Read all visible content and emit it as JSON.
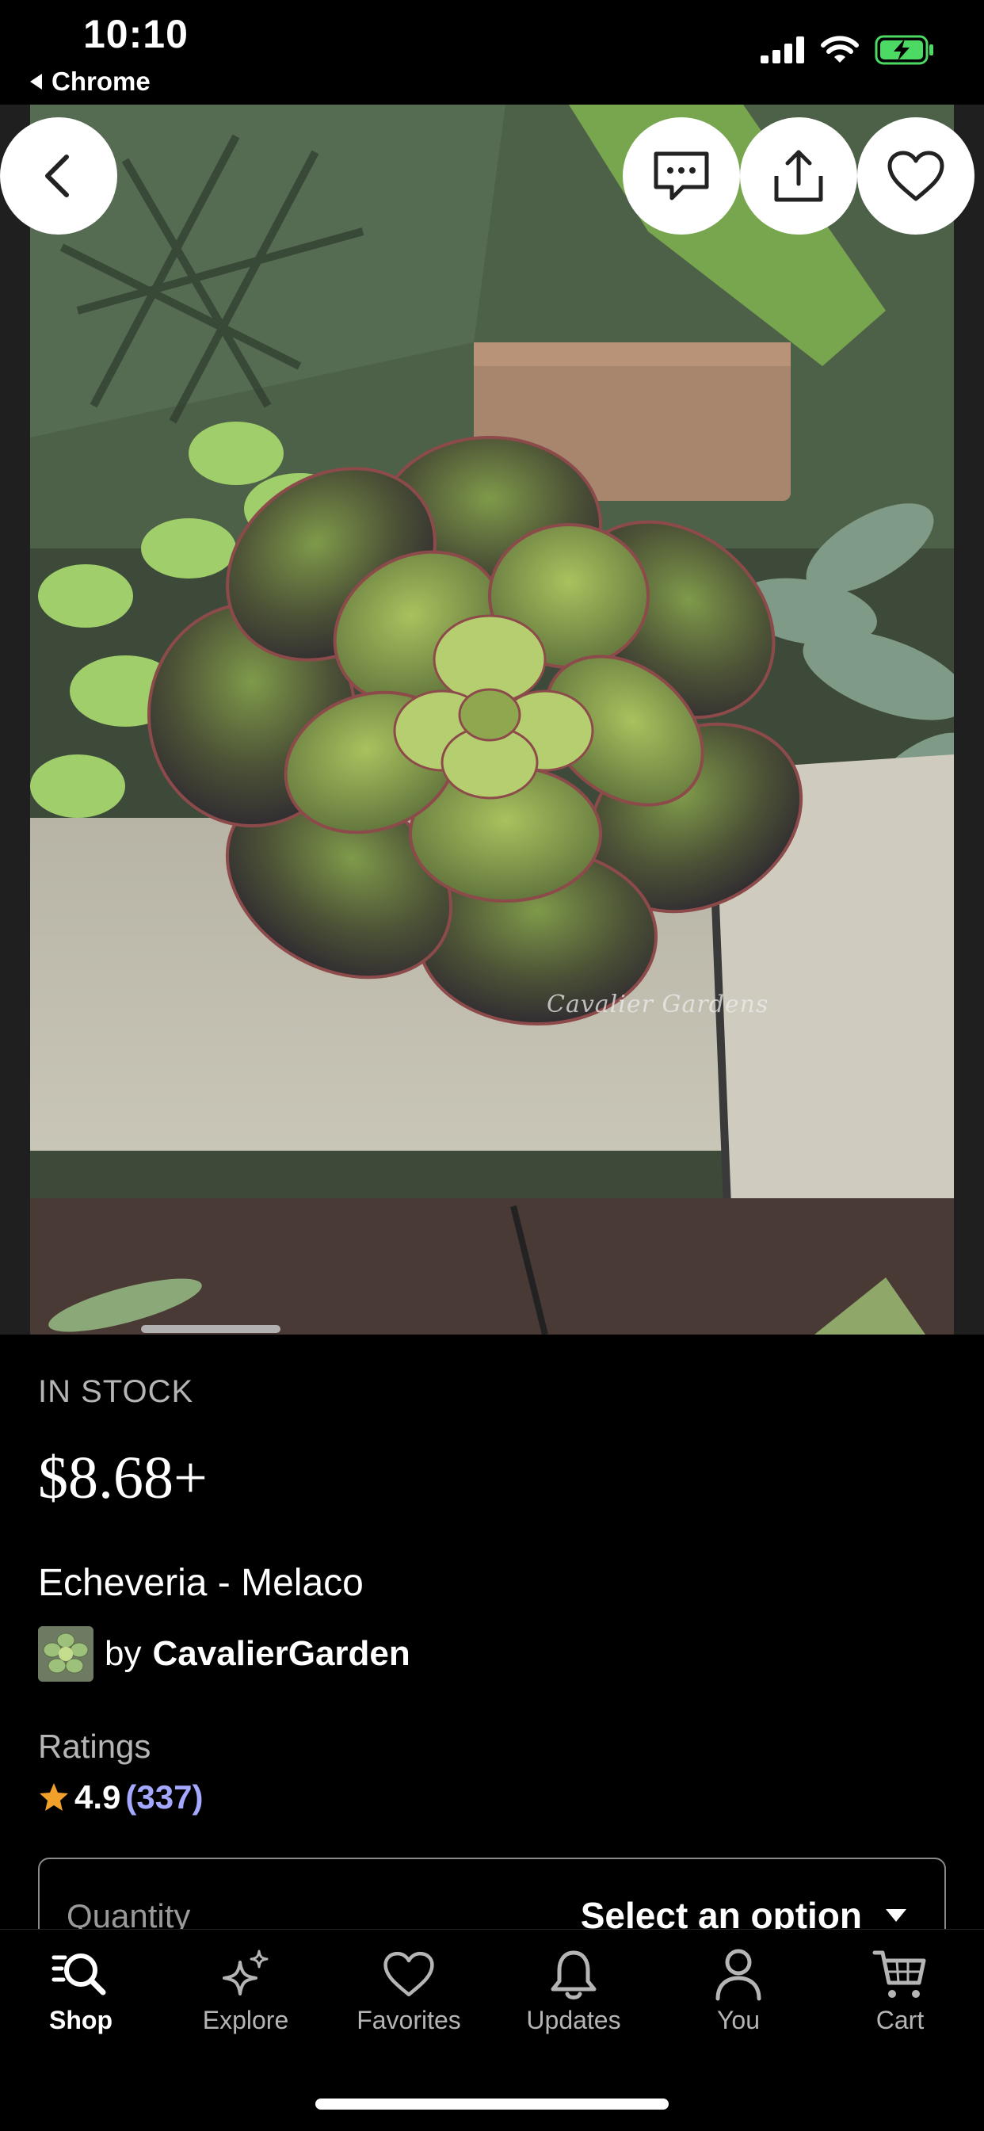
{
  "status_bar": {
    "time": "10:10",
    "back_app": "Chrome"
  },
  "hero": {
    "watermark": "Cavalier Gardens"
  },
  "listing": {
    "stock": "IN STOCK",
    "price": "$8.68+",
    "title": "Echeveria - Melaco",
    "by": "by",
    "shop_name": "CavalierGarden",
    "ratings_label": "Ratings",
    "rating": "4.9",
    "rating_count": "(337)",
    "quantity_label": "Quantity",
    "quantity_select": "Select an option"
  },
  "tabs": [
    {
      "label": "Shop",
      "icon": "shop-search-icon",
      "active": true
    },
    {
      "label": "Explore",
      "icon": "sparkle-icon"
    },
    {
      "label": "Favorites",
      "icon": "heart-icon"
    },
    {
      "label": "Updates",
      "icon": "bell-icon"
    },
    {
      "label": "You",
      "icon": "person-icon"
    },
    {
      "label": "Cart",
      "icon": "cart-icon"
    }
  ],
  "colors": {
    "background": "#000000",
    "link": "#a4a8ff",
    "star": "#f1a12a",
    "muted": "#b5b5b5",
    "battery": "#4cd964"
  }
}
